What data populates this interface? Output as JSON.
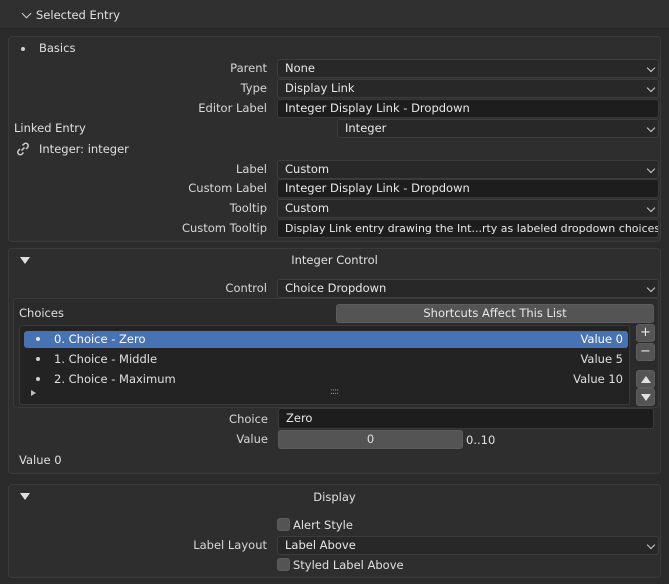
{
  "header": {
    "title": "Selected Entry"
  },
  "basics": {
    "title": "Basics",
    "parent": {
      "label": "Parent",
      "value": "None"
    },
    "type": {
      "label": "Type",
      "value": "Display Link"
    },
    "editor_label": {
      "label": "Editor Label",
      "value": "Integer Display Link - Dropdown"
    },
    "linked_entry": {
      "label": "Linked Entry",
      "value": "Integer"
    },
    "link_target": "Integer: integer",
    "label": {
      "label": "Label",
      "value": "Custom"
    },
    "custom_label": {
      "label": "Custom Label",
      "value": "Integer Display Link - Dropdown"
    },
    "tooltip": {
      "label": "Tooltip",
      "value": "Custom"
    },
    "custom_tooltip": {
      "label": "Custom Tooltip",
      "value": "Display Link entry drawing the Int...rty as labeled dropdown choices."
    }
  },
  "integer_control": {
    "title": "Integer Control",
    "control": {
      "label": "Control",
      "value": "Choice Dropdown"
    },
    "choices_label": "Choices",
    "shortcuts_button": "Shortcuts Affect This List",
    "items": [
      {
        "name": "0. Choice - Zero",
        "value": "Value 0",
        "selected": true
      },
      {
        "name": "1. Choice - Middle",
        "value": "Value 5",
        "selected": false
      },
      {
        "name": "2. Choice - Maximum",
        "value": "Value 10",
        "selected": false
      }
    ],
    "add_symbol": "+",
    "remove_symbol": "−",
    "resize_grip": "::::",
    "choice": {
      "label": "Choice",
      "value": "Zero"
    },
    "value": {
      "label": "Value",
      "value": "0",
      "range": "0..10"
    },
    "status": "Value 0"
  },
  "display": {
    "title": "Display",
    "alert_style": {
      "label": "Alert Style",
      "checked": false
    },
    "label_layout": {
      "label": "Label Layout",
      "value": "Label Above"
    },
    "styled_label_above": {
      "label": "Styled Label Above",
      "checked": false
    }
  },
  "colors": {
    "selected_row": "#4772b3",
    "panel": "#2e2e2e",
    "field": "#1d1d1d"
  }
}
